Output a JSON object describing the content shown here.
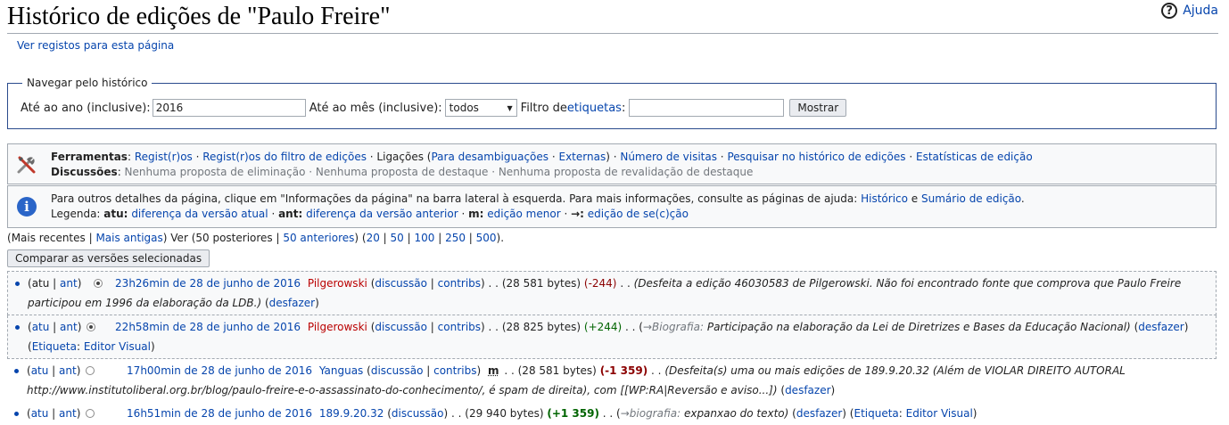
{
  "header": {
    "title": "Histórico de edições de \"Paulo Freire\"",
    "help_label": "Ajuda",
    "logs_link": "Ver registos para esta página"
  },
  "nav": {
    "legend": "Navegar pelo histórico",
    "year_label": "Até ao ano (inclusive):",
    "year_value": "2016",
    "month_label": "Até ao mês (inclusive):",
    "month_value": "todos",
    "tags_label_pre": "Filtro de ",
    "tags_label_link": "etiquetas",
    "tags_label_post": ":",
    "tags_value": "",
    "show_button": "Mostrar"
  },
  "tools": {
    "tools_label": "Ferramentas",
    "logs": "Regist(r)os",
    "filter_logs": "Regist(r)os do filtro de edições",
    "links_label": "Ligações (",
    "disamb": "Para desambiguações",
    "external": "Externas",
    "visits": "Número de visitas",
    "search_history": "Pesquisar no histórico de edições",
    "stats": "Estatísticas de edição",
    "discussions_label": "Discussões",
    "d1": "Nenhuma proposta de eliminação",
    "d2": "Nenhuma proposta de destaque",
    "d3": "Nenhuma proposta de revalidação de destaque"
  },
  "info": {
    "line1_pre": "Para outros detalhes da página, clique em \"Informações da página\" na barra lateral à esquerda. Para mais informações, consulte as páginas de ajuda: ",
    "historico": "Histórico",
    "e": " e ",
    "sumario": "Sumário de edição",
    "line1_post": ".",
    "legend_label": "Legenda: ",
    "atu_key": "atu:",
    "atu_desc": "diferença da versão atual",
    "ant_key": "ant:",
    "ant_desc": "diferença da versão anterior",
    "m_key": "m:",
    "m_desc": "edição menor",
    "arrow_key": "→:",
    "arrow_desc": "edição de se(c)ção"
  },
  "paging": {
    "recent": "Mais recentes",
    "older": "Mais antigas",
    "ver": " Ver (",
    "posteriores": "50 posteriores",
    "anteriores": "50 anteriores",
    "n20": "20",
    "n50": "50",
    "n100": "100",
    "n250": "250",
    "n500": "500"
  },
  "compare_button": "Comparar as versões selecionadas",
  "revisions": [
    {
      "atu": "atu",
      "ant": "ant",
      "date": "23h26min de 28 de junho de 2016",
      "user": "Pilgerowski",
      "talk": "discussão",
      "contribs": "contribs",
      "minor": "",
      "bytes": "(28 581 bytes)",
      "diff": "(-244)",
      "summary_a": "(Desfeita a edição 46030583 de ",
      "summary_user": "Pilgerowski",
      "summary_b": ". Não foi encontrado fonte que comprova que Paulo Freire participou em 1996 da elaboração da LDB.)",
      "undo": "desfazer",
      "tag": ""
    },
    {
      "atu": "atu",
      "ant": "ant",
      "date": "22h58min de 28 de junho de 2016",
      "user": "Pilgerowski",
      "talk": "discussão",
      "contribs": "contribs",
      "bytes": "(28 825 bytes)",
      "diff": "(+244)",
      "section": "→Biografia:",
      "summary": "Participação na elaboração da Lei de Diretrizes e Bases da Educação Nacional)",
      "undo": "desfazer",
      "tag_label": "Etiqueta",
      "tag": "Editor Visual"
    },
    {
      "atu": "atu",
      "ant": "ant",
      "date": "17h00min de 28 de junho de 2016",
      "user": "Yanguas",
      "talk": "discussão",
      "contribs": "contribs",
      "minor": "m",
      "bytes": "(28 581 bytes)",
      "diff": "(-1 359)",
      "summary_a": "(Desfeita(s) uma ou mais edições de ",
      "summary_ip": "189.9.20.32",
      "summary_b": " (Além de VIOLAR DIREITO AUTORAL http://www.institutoliberal.org.br/blog/paulo-freire-e-o-assassinato-do-conhecimento/, é spam de direita), com [[WP:RA|Reversão e aviso...]) ",
      "undo": "desfazer"
    },
    {
      "atu": "atu",
      "ant": "ant",
      "date": "16h51min de 28 de junho de 2016",
      "user": "189.9.20.32",
      "talk": "discussão",
      "bytes": "(29 940 bytes)",
      "diff": "(+1 359)",
      "section": "→biografia:",
      "summary": "expanxao do texto)",
      "undo": "desfazer",
      "tag_label": "Etiqueta",
      "tag": "Editor Visual"
    }
  ],
  "colors": {
    "link": "#0645ad",
    "redlink": "#ba0000",
    "positive": "#006400",
    "negative": "#8b0000",
    "border": "#a2a9b1"
  },
  "icons": [
    "help-icon",
    "tools-icon",
    "info-icon",
    "dropdown-arrow-icon",
    "radio-icon"
  ]
}
